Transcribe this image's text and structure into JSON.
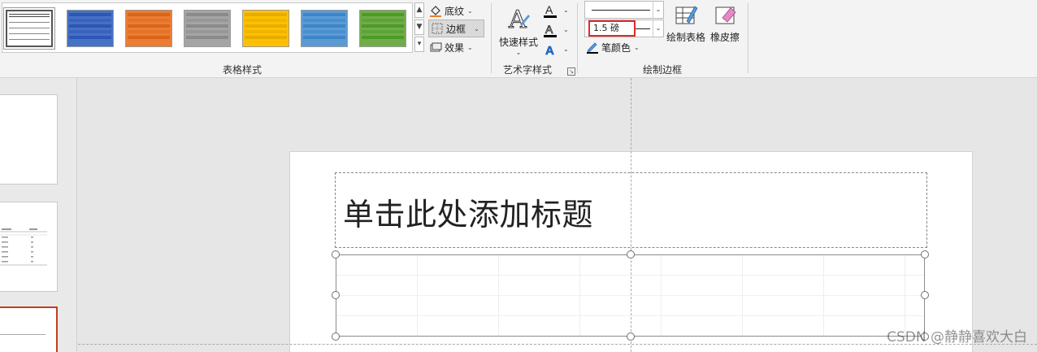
{
  "ribbon": {
    "table_styles_group_label": "表格样式",
    "shading_label": "底纹",
    "borders_label": "边框",
    "effects_label": "效果",
    "quick_styles_label": "快速样式",
    "art_text_group_label": "艺术字样式",
    "pen_weight_value": "1.5 磅",
    "pen_color_label": "笔颜色",
    "draw_table_label": "绘制表格",
    "eraser_label": "橡皮擦",
    "draw_borders_group_label": "绘制边框",
    "text_glyph": "A"
  },
  "gallery_swatches": [
    {
      "name": "table-style-plain",
      "header": "#ffffff",
      "row": "#e8e8e8",
      "border": "#444444"
    },
    {
      "name": "table-style-blue",
      "header": "#2f56b5",
      "row": "#4472c4",
      "border": "#2a4ea0"
    },
    {
      "name": "table-style-orange",
      "header": "#d8651c",
      "row": "#ed7d31",
      "border": "#c45a17"
    },
    {
      "name": "table-style-gray",
      "header": "#8a8a8a",
      "row": "#a5a5a5",
      "border": "#7a7a7a"
    },
    {
      "name": "table-style-gold",
      "header": "#e6ad00",
      "row": "#ffc000",
      "border": "#cc9a00"
    },
    {
      "name": "table-style-lightblue",
      "header": "#3d85c6",
      "row": "#5b9bd5",
      "border": "#3a78b8"
    },
    {
      "name": "table-style-green",
      "header": "#4c9a2a",
      "row": "#70ad47",
      "border": "#4a8a2c"
    }
  ],
  "slide": {
    "title_placeholder": "单击此处添加标题"
  },
  "watermark": "CSDN @静静喜欢大白",
  "colors": {
    "accent_red": "#e02a2a",
    "selected_thumb": "#c43e1c",
    "text_a_blue": "#1e6fd9"
  }
}
